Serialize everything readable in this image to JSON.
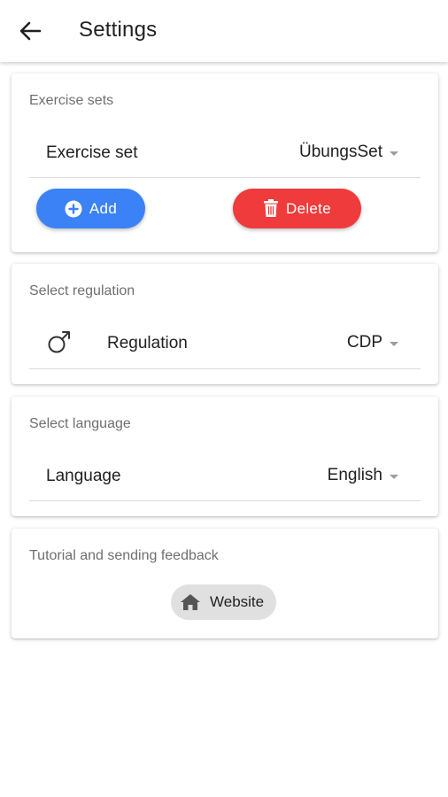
{
  "appbar": {
    "title": "Settings",
    "back_icon": "arrow-left-icon"
  },
  "exercise_sets": {
    "card_title": "Exercise sets",
    "label": "Exercise set",
    "selected": "ÜbungsSet",
    "add_label": "Add",
    "delete_label": "Delete",
    "add_color": "#3b82f6",
    "delete_color": "#ef3b3b"
  },
  "regulation": {
    "card_title": "Select regulation",
    "icon": "male-symbol-icon",
    "label": "Regulation",
    "selected": "CDP"
  },
  "language": {
    "card_title": "Select language",
    "label": "Language",
    "selected": "English"
  },
  "feedback": {
    "card_title": "Tutorial and sending feedback",
    "website_label": "Website",
    "website_icon": "home-icon"
  }
}
